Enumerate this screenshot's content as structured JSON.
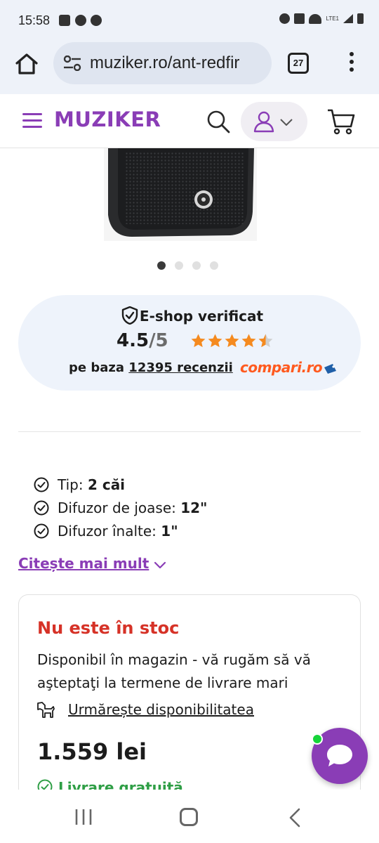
{
  "status_bar": {
    "time": "15:58",
    "network": "LTE1"
  },
  "browser": {
    "url": "muziker.ro/ant-redfir",
    "tab_count": "27",
    "home_icon": "home-icon",
    "menu_icon": "kebab-menu-icon"
  },
  "header": {
    "logo": "MUZIKER",
    "brand_color": "#8a3db6"
  },
  "gallery": {
    "slide_count": 4,
    "active_index": 0
  },
  "verified": {
    "title": "E-shop verificat",
    "rating_value": "4.5",
    "rating_denominator": "/5",
    "stars": 4.5,
    "basis_prefix": "pe baza",
    "review_count": "12395 recenzii",
    "provider": "compari.ro"
  },
  "features": [
    {
      "label": "Tip: ",
      "value": "2 căi"
    },
    {
      "label": "Difuzor de joase: ",
      "value": "12\""
    },
    {
      "label": "Difuzor înalte: ",
      "value": "1\""
    }
  ],
  "read_more": "Citește mai mult",
  "stock": {
    "status": "Nu este în stoc",
    "status_color": "#d63227",
    "availability": "Disponibil în magazin - vă rugăm să vă aşteptaţi la termene de livrare mari",
    "watch_label": "Urmărește disponibilitatea",
    "price": "1.559 lei",
    "delivery": "Livrare gratuită",
    "delivery_color": "#2e9e45"
  }
}
